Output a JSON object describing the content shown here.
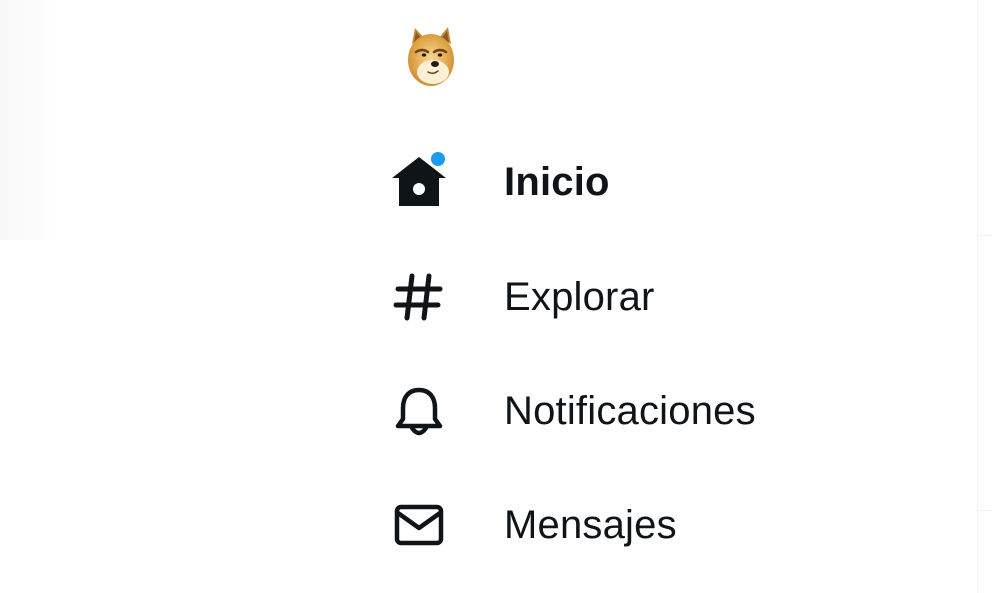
{
  "colors": {
    "text": "#0f1419",
    "notification_dot": "#1d9bf0",
    "divider": "#eff3f4"
  },
  "logo": {
    "icon": "doge-icon"
  },
  "nav": {
    "items": [
      {
        "label": "Inicio",
        "icon": "home-icon",
        "active": true,
        "has_notification": true
      },
      {
        "label": "Explorar",
        "icon": "hashtag-icon",
        "active": false,
        "has_notification": false
      },
      {
        "label": "Notificaciones",
        "icon": "bell-icon",
        "active": false,
        "has_notification": false
      },
      {
        "label": "Mensajes",
        "icon": "envelope-icon",
        "active": false,
        "has_notification": false
      }
    ]
  }
}
